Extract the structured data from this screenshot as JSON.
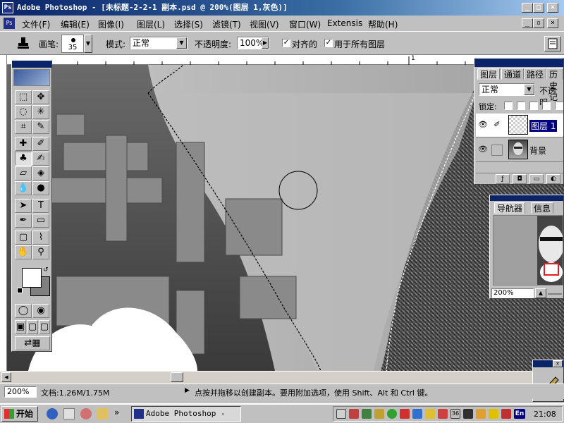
{
  "window": {
    "title": "Adobe Photoshop - [未标题-2-2-1  副本.psd @ 200%(图层 1,灰色)]",
    "icon_text": "Ps"
  },
  "menu": [
    "文件(F)",
    "编辑(E)",
    "图像(I)",
    "图层(L)",
    "选择(S)",
    "滤镜(T)",
    "视图(V)",
    "窗口(W)",
    "Extensis",
    "帮助(H)"
  ],
  "options": {
    "brush_label": "画笔:",
    "brush_size": "35",
    "mode_label": "模式:",
    "mode_value": "正常",
    "opacity_label": "不透明度:",
    "opacity_value": "100%",
    "aligned_label": "对齐的",
    "all_layers_label": "用于所有图层"
  },
  "ruler": {
    "mark": "1"
  },
  "layers_panel": {
    "tabs": [
      "图层",
      "通道",
      "路径",
      "历史记"
    ],
    "blend_mode": "正常",
    "opacity_label": "不透明",
    "lock_label": "锁定:",
    "layers": [
      {
        "name": "图层 1",
        "selected": true
      },
      {
        "name": "背景",
        "selected": false
      }
    ]
  },
  "navigator": {
    "tabs": [
      "导航器",
      "信息"
    ],
    "zoom": "200%"
  },
  "status": {
    "zoom": "200%",
    "doc_info": "文档:1.26M/1.75M",
    "hint": "点按并拖移以创建副本。要用附加选项，使用 Shift、Alt 和 Ctrl 键。"
  },
  "taskbar": {
    "start": "开始",
    "app_button": "Adobe Photoshop - [...",
    "chevron": "»",
    "time": "21:08",
    "ime": "En",
    "tray_num": "36"
  },
  "colors": {
    "titlebar_start": "#0a246a",
    "titlebar_end": "#a6caf0",
    "panel_bg": "#c0c0c0",
    "selected_layer": "#000080"
  }
}
